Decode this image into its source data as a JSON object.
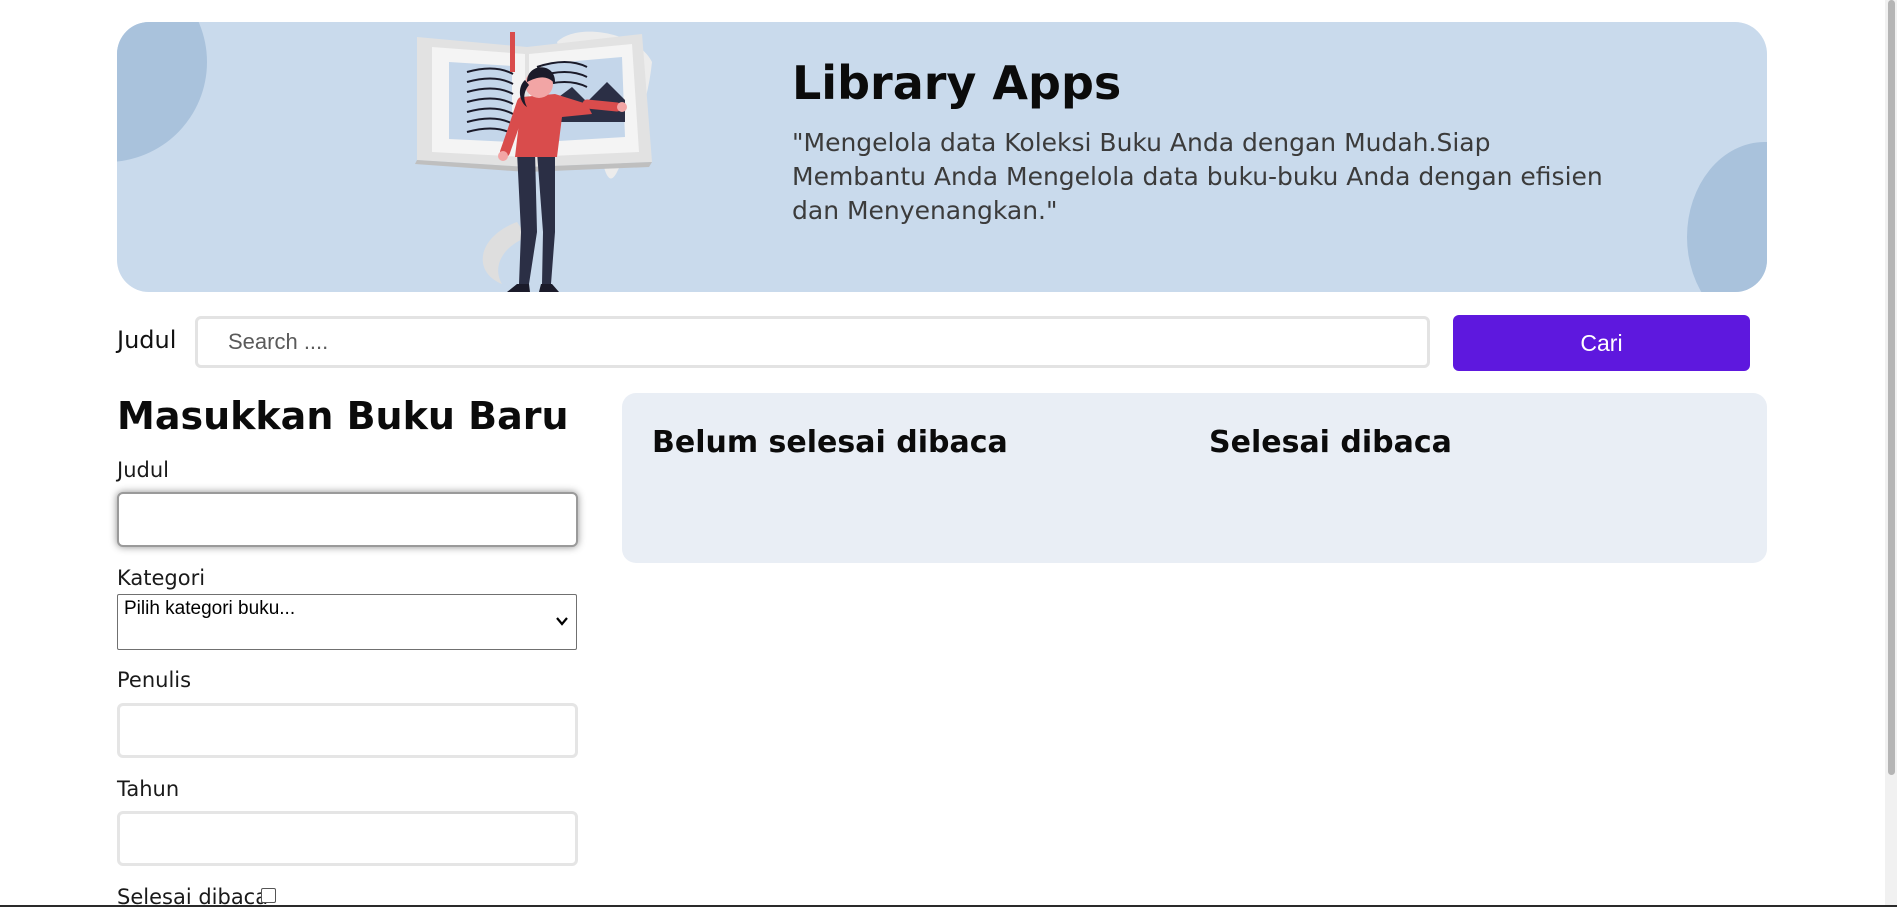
{
  "hero": {
    "title": "Library Apps",
    "tagline": "\"Mengelola data Koleksi Buku Anda dengan Mudah.Siap Membantu Anda Mengelola data buku-buku Anda dengan efisien dan Menyenangkan.\"",
    "illustration_icon": "woman-reading-open-book-illustration",
    "background_color": "#c9daec",
    "blob_color": "#a9c2dc"
  },
  "search": {
    "label": "Judul",
    "placeholder": "Search ....",
    "value": "",
    "button_label": "Cari",
    "button_color": "#5e18de"
  },
  "form": {
    "title": "Masukkan Buku Baru",
    "title_label": "Judul",
    "title_value": "",
    "category_label": "Kategori",
    "category_selected": "Pilih kategori buku...",
    "author_label": "Penulis",
    "author_value": "",
    "year_label": "Tahun",
    "year_value": "",
    "finished_label": "Selesai dibaca",
    "finished_checked": false
  },
  "shelves": {
    "unread_title": "Belum selesai dibaca",
    "read_title": "Selesai dibaca",
    "background_color": "#e9eef5"
  }
}
